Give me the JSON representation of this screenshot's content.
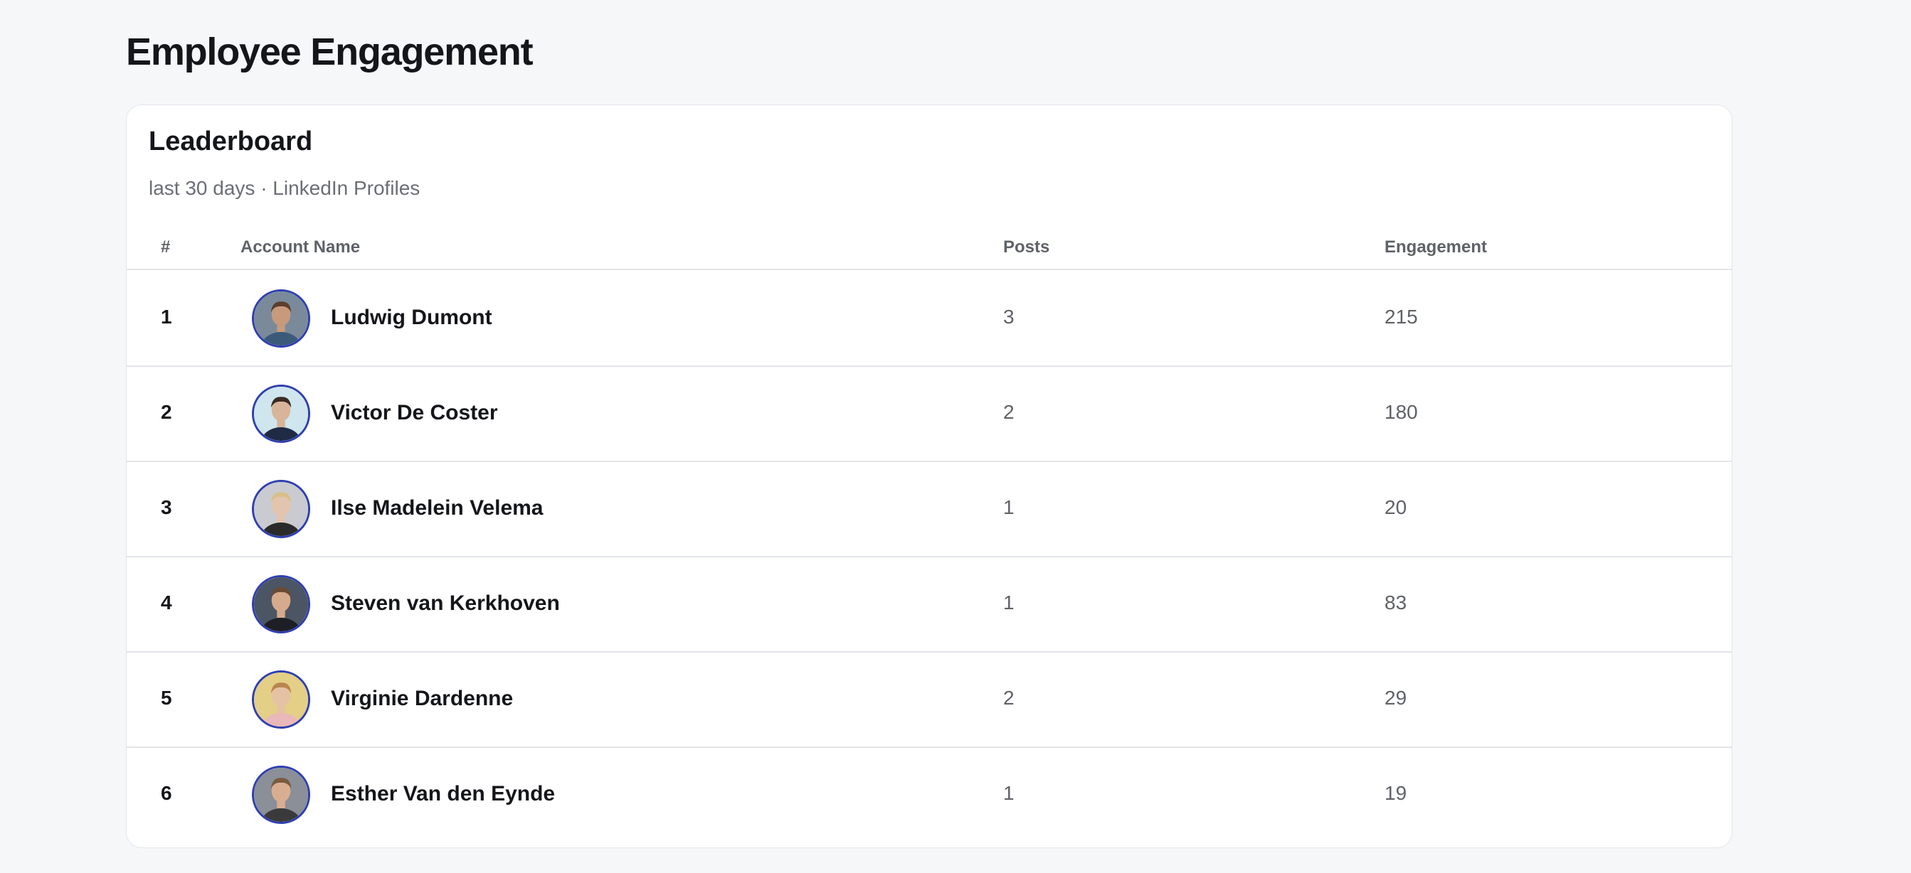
{
  "page": {
    "title": "Employee Engagement"
  },
  "leaderboard": {
    "title": "Leaderboard",
    "subtitle": "last 30 days · LinkedIn Profiles",
    "columns": {
      "rank": "#",
      "name": "Account Name",
      "posts": "Posts",
      "engagement": "Engagement"
    },
    "rows": [
      {
        "rank": "1",
        "name": "Ludwig Dumont",
        "posts": "3",
        "engagement": "215",
        "avatar": {
          "bg": "#7a8a9a",
          "skin": "#c79a7c",
          "hair": "#5a3e2b",
          "shirt": "#3b5a7a"
        }
      },
      {
        "rank": "2",
        "name": "Victor De Coster",
        "posts": "2",
        "engagement": "180",
        "avatar": {
          "bg": "#cfe6ee",
          "skin": "#d9b49a",
          "hair": "#3a2b22",
          "shirt": "#1f2a44"
        }
      },
      {
        "rank": "3",
        "name": "Ilse Madelein Velema",
        "posts": "1",
        "engagement": "20",
        "avatar": {
          "bg": "#c9cbd0",
          "skin": "#e3c4ae",
          "hair": "#d8c08a",
          "shirt": "#2a2a2a"
        }
      },
      {
        "rank": "4",
        "name": "Steven van Kerkhoven",
        "posts": "1",
        "engagement": "83",
        "avatar": {
          "bg": "#4b5563",
          "skin": "#d6aa8c",
          "hair": "#6b4a33",
          "shirt": "#1d1f24"
        }
      },
      {
        "rank": "5",
        "name": "Virginie Dardenne",
        "posts": "2",
        "engagement": "29",
        "avatar": {
          "bg": "#e3cf86",
          "skin": "#e6c2a4",
          "hair": "#b9864e",
          "shirt": "#e9b8b8"
        }
      },
      {
        "rank": "6",
        "name": "Esther Van den Eynde",
        "posts": "1",
        "engagement": "19",
        "avatar": {
          "bg": "#8a8f98",
          "skin": "#d9ae90",
          "hair": "#7a5a3e",
          "shirt": "#3a3a3a"
        }
      }
    ]
  }
}
